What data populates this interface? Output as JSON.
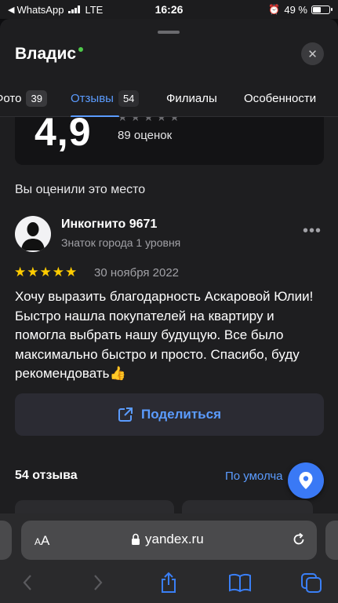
{
  "status_bar": {
    "back_app": "WhatsApp",
    "network": "LTE",
    "time": "16:26",
    "battery": "49 %",
    "battery_level": 0.49
  },
  "sheet": {
    "title": "Владис",
    "tabs": [
      {
        "label": "Фото",
        "count": "39"
      },
      {
        "label": "Отзывы",
        "count": "54"
      },
      {
        "label": "Филиалы"
      },
      {
        "label": "Особенности"
      }
    ],
    "rating": {
      "value": "4,9",
      "count": "89 оценок"
    },
    "you_rated_heading": "Вы оценили это место",
    "review": {
      "author": "Инкогнито 9671",
      "level": "Знаток города 1 уровня",
      "stars": 5,
      "date": "30 ноября 2022",
      "text": "Хочу выразить благодарность Аскаровой Юлии! Быстро нашла покупателей на квартиру и помогла выбрать нашу будущую. Все было максимально быстро и просто. Спасибо, буду рекомендовать👍"
    },
    "share_label": "Поделиться",
    "reviews_count": "54 отзыва",
    "sort_label": "По умолча"
  },
  "safari": {
    "aa_label": "AA",
    "url": "yandex.ru"
  },
  "colors": {
    "accent": "#5b9cff",
    "star": "#ffcc00",
    "fab": "#3a79f5"
  }
}
